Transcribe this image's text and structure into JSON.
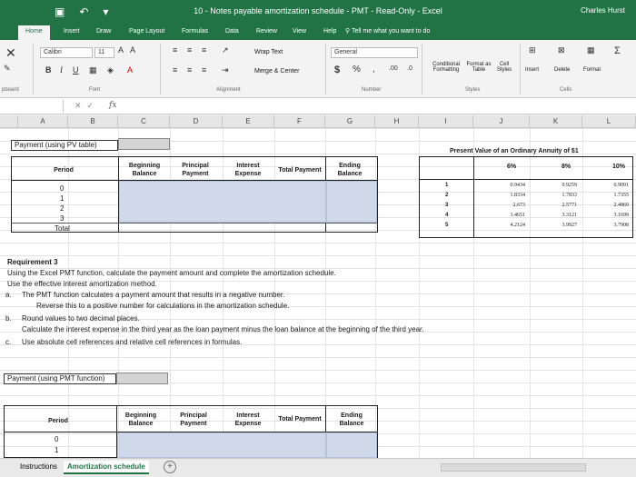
{
  "titlebar": {
    "title": "10 - Notes payable amortization schedule - PMT  -  Read-Only  -  Excel",
    "user": "Charles Hurst",
    "save_icon": "save-icon",
    "undo_icon": "undo-icon"
  },
  "tabs": [
    {
      "label": "Home",
      "active": true
    },
    {
      "label": "Insert"
    },
    {
      "label": "Draw"
    },
    {
      "label": "Page Layout"
    },
    {
      "label": "Formulas"
    },
    {
      "label": "Data"
    },
    {
      "label": "Review"
    },
    {
      "label": "View"
    },
    {
      "label": "Help"
    }
  ],
  "tell_me": "Tell me what you want to do",
  "ribbon": {
    "font_name": "Calibri",
    "font_size": "11",
    "wrap_text": "Wrap Text",
    "merge_center": "Merge & Center",
    "number_format": "General",
    "conditional_formatting": "Conditional Formatting",
    "format_as_table": "Format as Table",
    "cell_styles": "Cell Styles",
    "insert": "Insert",
    "delete": "Delete",
    "format": "Format",
    "groups": {
      "clipboard": "pboard",
      "font": "Font",
      "alignment": "Alignment",
      "number": "Number",
      "styles": "Styles",
      "cells": "Cells"
    }
  },
  "formula_bar": {
    "fx": "fx"
  },
  "columns": [
    "A",
    "B",
    "C",
    "D",
    "E",
    "F",
    "G",
    "H",
    "I",
    "J",
    "K",
    "L"
  ],
  "table1": {
    "label": "Payment (using PV table)",
    "headers": {
      "period": "Period",
      "beginning": "Beginning Balance",
      "principal": "Principal Payment",
      "interest": "Interest Expense",
      "total": "Total Payment",
      "ending": "Ending Balance"
    },
    "periods": [
      "0",
      "1",
      "2",
      "3"
    ],
    "total_label": "Total"
  },
  "pv_table": {
    "title": "Present Value of an Ordinary Annuity of $1",
    "rates": [
      "6%",
      "8%",
      "10%"
    ],
    "periods": [
      "1",
      "2",
      "3",
      "4",
      "5"
    ],
    "rows": [
      [
        "0.9434",
        "0.9259",
        "0.9091"
      ],
      [
        "1.8334",
        "1.7833",
        "1.7355"
      ],
      [
        "2.673",
        "2.5771",
        "2.4869"
      ],
      [
        "3.4651",
        "3.3121",
        "3.1699"
      ],
      [
        "4.2124",
        "3.9927",
        "3.7908"
      ]
    ]
  },
  "requirement": {
    "heading": "Requirement 3",
    "line1": "Using the Excel PMT function, calculate the payment amount and complete the amortization schedule.",
    "line2": "Use the effective interest amortization method.",
    "a_label": "a.",
    "a_text": "The PMT function calculates a payment amount that results in a negative number.",
    "a_text2": "Reverse this to a positive number for calculations in the amortization schedule.",
    "b_label": "b.",
    "b_text": "Round values to two decimal places.",
    "b_text2": "Calculate the interest expense in the third year as the loan payment minus the loan balance at the beginning of the third year.",
    "c_label": "c.",
    "c_text": "Use absolute cell references and relative cell references in formulas."
  },
  "table2": {
    "label": "Payment (using PMT function)",
    "headers": {
      "period": "Period",
      "beginning": "Beginning Balance",
      "principal": "Principal Payment",
      "interest": "Interest Expense",
      "total": "Total Payment",
      "ending": "Ending Balance"
    },
    "periods": [
      "0",
      "1"
    ]
  },
  "sheets": [
    {
      "label": "Instructions"
    },
    {
      "label": "Amortization schedule",
      "active": true
    }
  ]
}
